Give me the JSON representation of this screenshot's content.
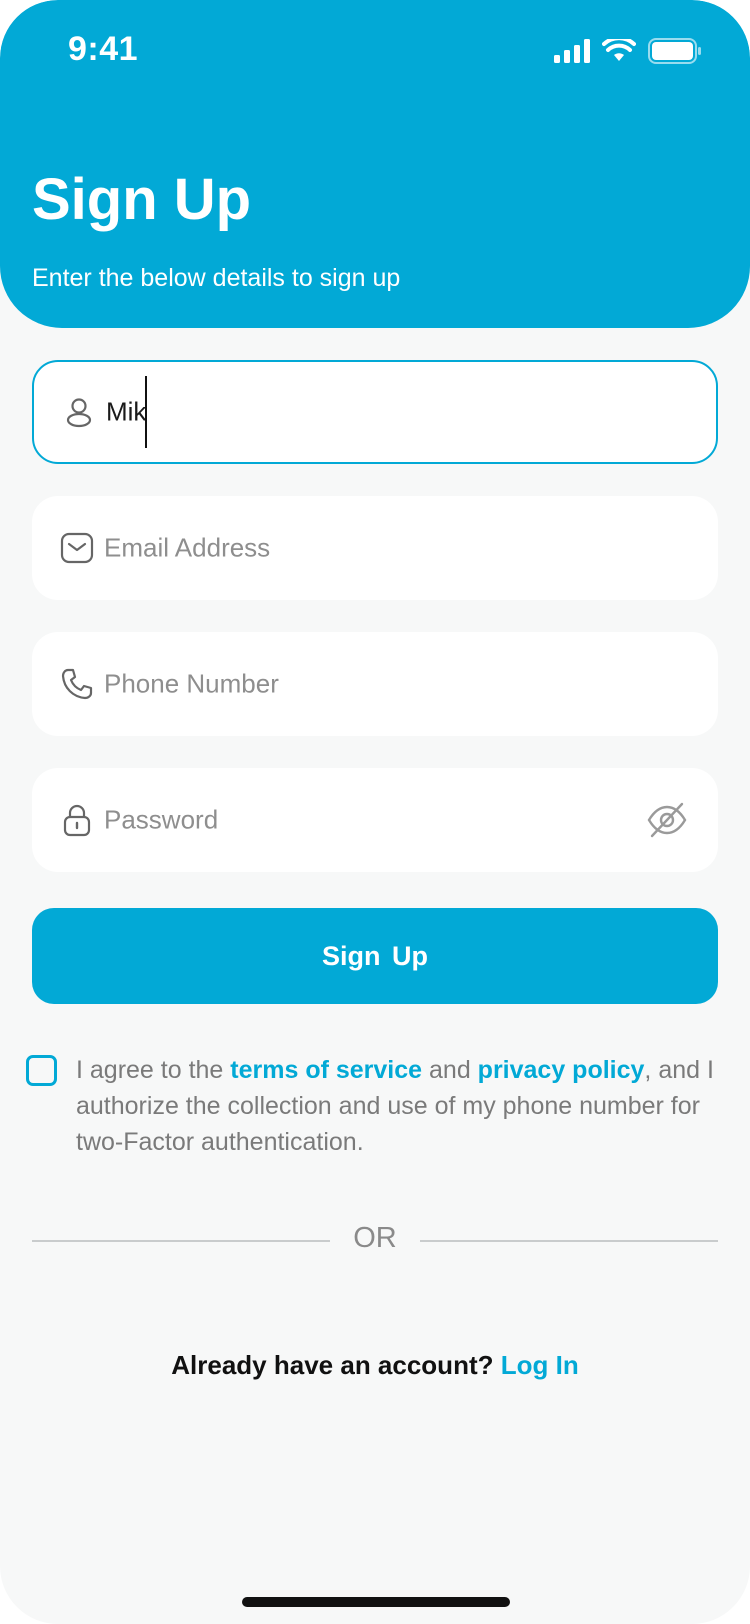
{
  "status_bar": {
    "time": "9:41"
  },
  "header": {
    "title": "Sign Up",
    "subtitle": "Enter the below details to sign up"
  },
  "form": {
    "name": {
      "value": "Mik",
      "icon": "user-icon"
    },
    "email": {
      "placeholder": "Email Address",
      "icon": "mail-icon"
    },
    "phone": {
      "placeholder": "Phone Number",
      "icon": "phone-icon"
    },
    "password": {
      "placeholder": "Password",
      "icon": "lock-icon",
      "toggle_icon": "eye-off-icon"
    },
    "submit_label": "Sign Up"
  },
  "agreement": {
    "prefix": "I agree to the ",
    "terms_link": "terms of service",
    "and": " and ",
    "privacy_link": "privacy policy",
    "suffix": ", and I authorize the collection and use of my phone number for two-Factor authentication.",
    "checked": false
  },
  "divider": {
    "label": "OR"
  },
  "login": {
    "prompt": "Already have an account?",
    "link": "Log In"
  },
  "colors": {
    "accent": "#02a9d6",
    "background": "#f7f8f8"
  }
}
